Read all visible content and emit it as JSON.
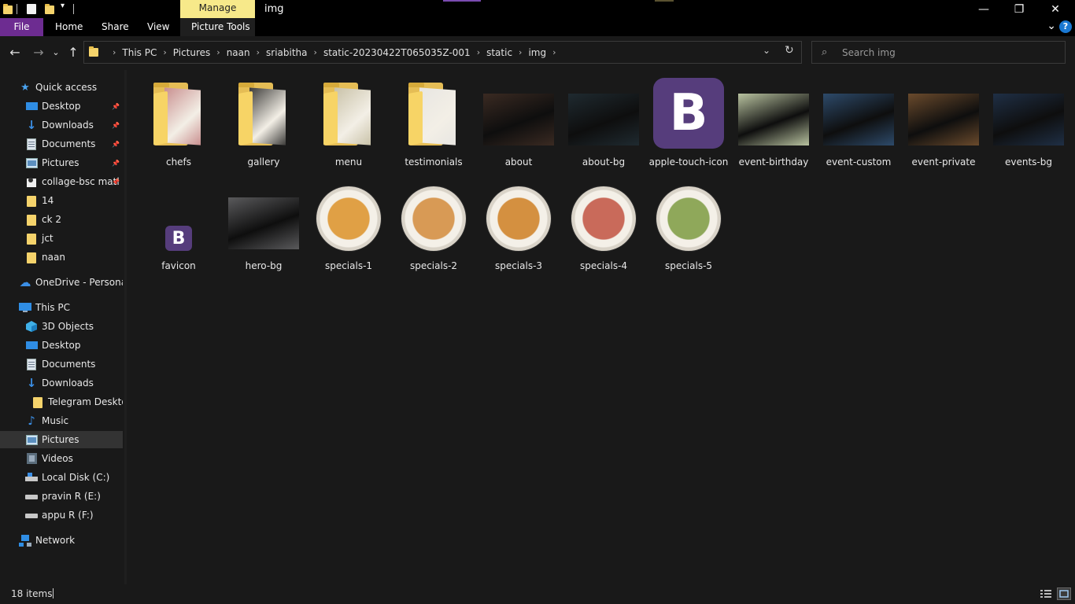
{
  "window": {
    "title": "img",
    "manage_tab": "Manage",
    "controls": {
      "minimize": "—",
      "maximize": "❐",
      "close": "✕"
    }
  },
  "ribbon": {
    "file": "File",
    "tabs": [
      "Home",
      "Share",
      "View",
      "Picture Tools"
    ],
    "help": "?"
  },
  "address": {
    "crumbs": [
      "This PC",
      "Pictures",
      "naan",
      "sriabitha",
      "static-20230422T065035Z-001",
      "static",
      "img"
    ]
  },
  "search": {
    "placeholder": "Search img"
  },
  "nav": {
    "quick_access": "Quick access",
    "qa_items": [
      "Desktop",
      "Downloads",
      "Documents",
      "Pictures",
      "collage-bsc matl",
      "14",
      "ck 2",
      "jct",
      "naan"
    ],
    "onedrive": "OneDrive - Personal",
    "this_pc": "This PC",
    "pc_items": [
      "3D Objects",
      "Desktop",
      "Documents",
      "Downloads",
      "Telegram Desktop",
      "Music",
      "Pictures",
      "Videos",
      "Local Disk (C:)",
      "pravin R  (E:)",
      "appu R  (F:)"
    ],
    "network": "Network"
  },
  "files": [
    {
      "name": "chefs",
      "kind": "folder",
      "tint": "#c98f8f"
    },
    {
      "name": "gallery",
      "kind": "folder",
      "tint": "#3b3a38"
    },
    {
      "name": "menu",
      "kind": "folder",
      "tint": "#c9c2a8"
    },
    {
      "name": "testimonials",
      "kind": "folder",
      "tint": "#e8e6e2"
    },
    {
      "name": "about",
      "kind": "photo",
      "tint": "#3a2a22"
    },
    {
      "name": "about-bg",
      "kind": "photo",
      "tint": "#1f2a30"
    },
    {
      "name": "apple-touch-icon",
      "kind": "bootstrap-big",
      "glyph": "B"
    },
    {
      "name": "event-birthday",
      "kind": "photo",
      "tint": "#b9c3a0"
    },
    {
      "name": "event-custom",
      "kind": "photo",
      "tint": "#2d4a6a"
    },
    {
      "name": "event-private",
      "kind": "photo",
      "tint": "#6a4a2c"
    },
    {
      "name": "events-bg",
      "kind": "photo",
      "tint": "#1f2f45"
    },
    {
      "name": "favicon",
      "kind": "bootstrap-small",
      "glyph": "B"
    },
    {
      "name": "hero-bg",
      "kind": "photo",
      "tint": "#5a5a5c"
    },
    {
      "name": "specials-1",
      "kind": "plate",
      "tint": "#e0a045"
    },
    {
      "name": "specials-2",
      "kind": "plate",
      "tint": "#d89a55"
    },
    {
      "name": "specials-3",
      "kind": "plate",
      "tint": "#d49040"
    },
    {
      "name": "specials-4",
      "kind": "plate",
      "tint": "#c96a5a"
    },
    {
      "name": "specials-5",
      "kind": "plate",
      "tint": "#8fa85a"
    }
  ],
  "status": {
    "count": "18 items"
  },
  "colors": {
    "accent": "#6d2c91",
    "manage": "#f7e98a",
    "selected": "#333333"
  }
}
